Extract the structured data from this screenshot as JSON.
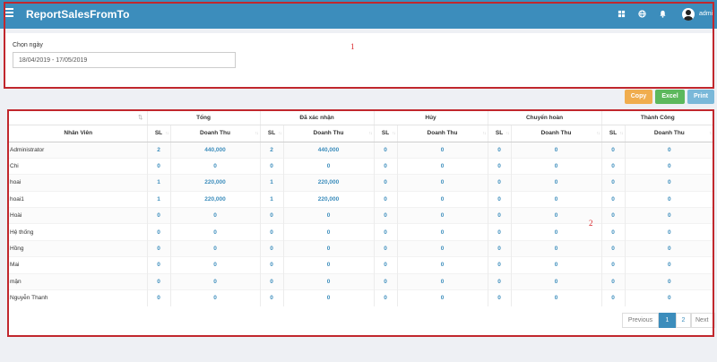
{
  "header": {
    "title": "ReportSalesFromTo",
    "user": "admi",
    "icons": [
      "menu-icon",
      "grid-icon",
      "globe-icon",
      "bell-icon",
      "user-avatar"
    ]
  },
  "filter": {
    "label": "Chọn ngày",
    "date_range": "18/04/2019 - 17/05/2019"
  },
  "annotations": {
    "box1": "1",
    "box2": "2"
  },
  "actions": {
    "copy": "Copy",
    "excel": "Excel",
    "print": "Print"
  },
  "colors": {
    "header": "#3c8dbc",
    "copy": "#f0ad4e",
    "excel": "#5cb85c",
    "print": "#7ab8d9",
    "highlight": "#c1272d"
  },
  "table": {
    "groups": [
      "Tổng",
      "Đã xác nhận",
      "Hủy",
      "Chuyển hoàn",
      "Thành Công"
    ],
    "col_name": "Nhân Viên",
    "col_sl": "SL",
    "col_dt": "Doanh Thu",
    "rows": [
      {
        "name": "Administrator",
        "v": [
          "2",
          "440,000",
          "2",
          "440,000",
          "0",
          "0",
          "0",
          "0",
          "0",
          "0"
        ]
      },
      {
        "name": "Chi",
        "v": [
          "0",
          "0",
          "0",
          "0",
          "0",
          "0",
          "0",
          "0",
          "0",
          "0"
        ]
      },
      {
        "name": "hoai",
        "v": [
          "1",
          "220,000",
          "1",
          "220,000",
          "0",
          "0",
          "0",
          "0",
          "0",
          "0"
        ]
      },
      {
        "name": "hoai1",
        "v": [
          "1",
          "220,000",
          "1",
          "220,000",
          "0",
          "0",
          "0",
          "0",
          "0",
          "0"
        ]
      },
      {
        "name": "Hoài",
        "v": [
          "0",
          "0",
          "0",
          "0",
          "0",
          "0",
          "0",
          "0",
          "0",
          "0"
        ]
      },
      {
        "name": "Hệ thống",
        "v": [
          "0",
          "0",
          "0",
          "0",
          "0",
          "0",
          "0",
          "0",
          "0",
          "0"
        ]
      },
      {
        "name": "Hồng",
        "v": [
          "0",
          "0",
          "0",
          "0",
          "0",
          "0",
          "0",
          "0",
          "0",
          "0"
        ]
      },
      {
        "name": "Mai",
        "v": [
          "0",
          "0",
          "0",
          "0",
          "0",
          "0",
          "0",
          "0",
          "0",
          "0"
        ]
      },
      {
        "name": "mận",
        "v": [
          "0",
          "0",
          "0",
          "0",
          "0",
          "0",
          "0",
          "0",
          "0",
          "0"
        ]
      },
      {
        "name": "Nguyễn Thanh",
        "v": [
          "0",
          "0",
          "0",
          "0",
          "0",
          "0",
          "0",
          "0",
          "0",
          "0"
        ]
      }
    ]
  },
  "pagination": {
    "prev": "Previous",
    "pages": [
      "1",
      "2"
    ],
    "current": "1",
    "next": "Next"
  }
}
